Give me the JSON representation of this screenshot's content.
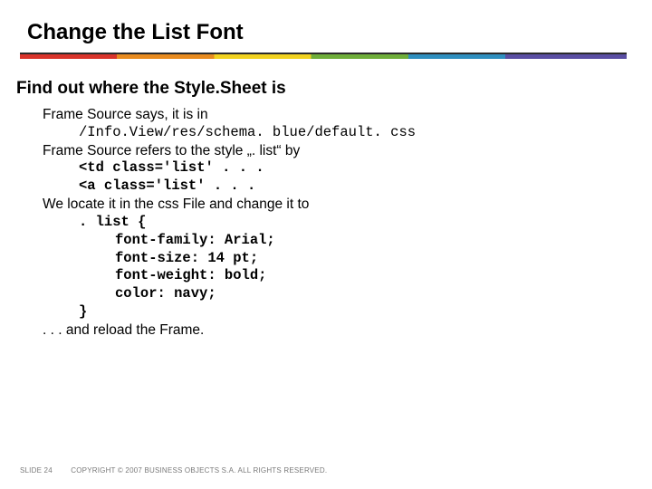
{
  "title": "Change the List Font",
  "section": "Find out where the Style.Sheet is",
  "lines": {
    "l1": "Frame Source says, it is in",
    "l2": "/Info.View/res/schema. blue/default. css",
    "l3a": "Frame Source refers to the style „",
    "l3b": ". list",
    "l3c": "“ by",
    "l4": "<td class='list' . . .",
    "l5": "<a class='list' . . .",
    "l6": "We locate it in the css File and change it to",
    "l7": ". list {",
    "l8": "font-family: Arial;",
    "l9": "font-size: 14 pt;",
    "l10": "font-weight: bold;",
    "l11": "color: navy;",
    "l12": "}",
    "l13": ". . . and reload the Frame."
  },
  "footer": {
    "slide": "SLIDE 24",
    "copyright": "COPYRIGHT © 2007 BUSINESS OBJECTS S.A.  ALL RIGHTS RESERVED."
  }
}
